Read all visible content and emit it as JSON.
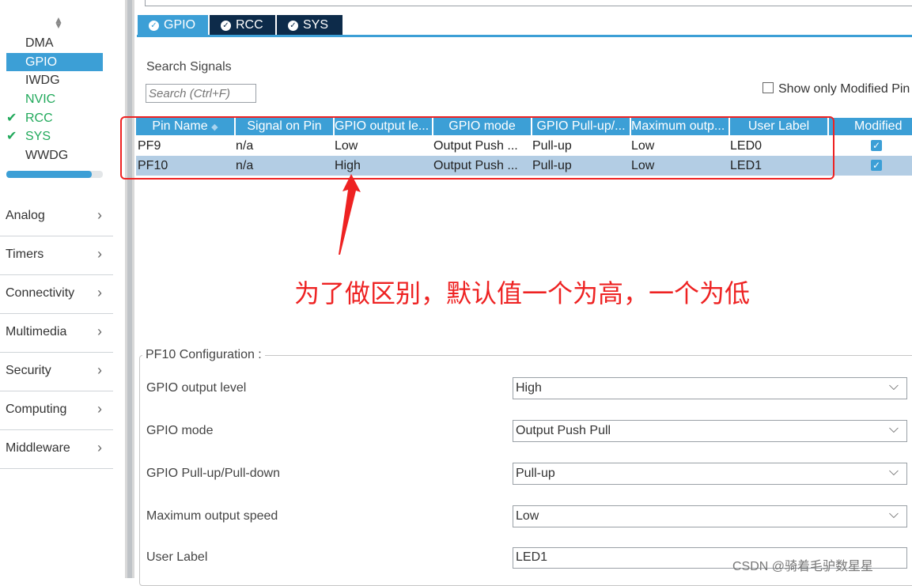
{
  "sidebar": {
    "sys_items": [
      {
        "label": "DMA",
        "checked": false,
        "state": "normal"
      },
      {
        "label": "GPIO",
        "checked": false,
        "state": "selected"
      },
      {
        "label": "IWDG",
        "checked": false,
        "state": "normal"
      },
      {
        "label": "NVIC",
        "checked": false,
        "state": "green"
      },
      {
        "label": "RCC",
        "checked": true,
        "state": "green"
      },
      {
        "label": "SYS",
        "checked": true,
        "state": "green"
      },
      {
        "label": "WWDG",
        "checked": false,
        "state": "normal"
      }
    ],
    "categories": [
      "Analog",
      "Timers",
      "Connectivity",
      "Multimedia",
      "Security",
      "Computing",
      "Middleware"
    ]
  },
  "tabs": [
    {
      "label": "GPIO",
      "active": true
    },
    {
      "label": "RCC",
      "active": false
    },
    {
      "label": "SYS",
      "active": false
    }
  ],
  "search": {
    "label": "Search Signals",
    "placeholder": "Search (Ctrl+F)",
    "show_modified": "Show only Modified Pin"
  },
  "table": {
    "headers": [
      "Pin Name",
      "Signal on Pin",
      "GPIO output le...",
      "GPIO mode",
      "GPIO Pull-up/...",
      "Maximum outp...",
      "User Label",
      "Modified"
    ],
    "rows": [
      {
        "pin": "PF9",
        "signal": "n/a",
        "level": "Low",
        "mode": "Output Push ...",
        "pull": "Pull-up",
        "speed": "Low",
        "label": "LED0",
        "modified": true
      },
      {
        "pin": "PF10",
        "signal": "n/a",
        "level": "High",
        "mode": "Output Push ...",
        "pull": "Pull-up",
        "speed": "Low",
        "label": "LED1",
        "modified": true
      }
    ]
  },
  "annotation": "为了做区别，默认值一个为高，一个为低",
  "config": {
    "title": "PF10 Configuration :",
    "fields": [
      {
        "label": "GPIO output level",
        "value": "High"
      },
      {
        "label": "GPIO mode",
        "value": "Output Push Pull"
      },
      {
        "label": "GPIO Pull-up/Pull-down",
        "value": "Pull-up"
      },
      {
        "label": "Maximum output speed",
        "value": "Low"
      },
      {
        "label": "User Label",
        "value": "LED1"
      }
    ]
  },
  "watermark": "CSDN @骑着毛驴数星星",
  "colors": {
    "accent": "#3c9fd6",
    "tab_dark": "#0d2b4a",
    "enabled_green": "#21a95b",
    "annotation_red": "#e22222",
    "selected_row": "#b3cde4"
  }
}
